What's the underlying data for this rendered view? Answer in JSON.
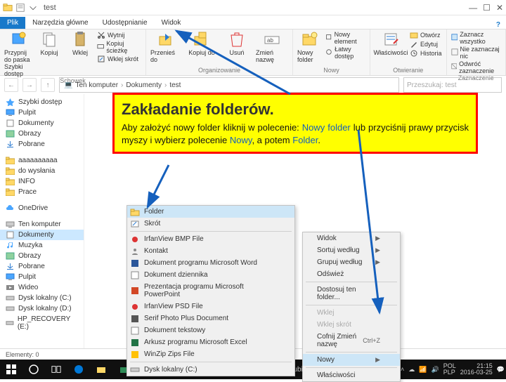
{
  "titlebar": {
    "title": "test"
  },
  "tabs": {
    "plik": "Plik",
    "glowne": "Narzędzia główne",
    "udostep": "Udostępnianie",
    "widok": "Widok"
  },
  "ribbon": {
    "group1": {
      "pin": "Przypnij do paska Szybki dostęp",
      "kopiuj": "Kopiuj",
      "wklej": "Wklej",
      "wytnij": "Wytnij",
      "skopiuj_sciezke": "Kopiuj ścieżkę",
      "wklej_skrot": "Wklej skrót",
      "label": "Schowek"
    },
    "group2": {
      "przenies": "Przenieś do",
      "kopiuj_do": "Kopiuj do",
      "usun": "Usuń",
      "zmien": "Zmień nazwę",
      "label": "Organizowanie"
    },
    "group3": {
      "nowy": "Nowy folder",
      "nowy_el": "Nowy element",
      "latwy": "Łatwy dostęp",
      "label": "Nowy"
    },
    "group4": {
      "wlasc": "Właściwości",
      "otworz": "Otwórz",
      "edytuj": "Edytuj",
      "historia": "Historia",
      "label": "Otwieranie"
    },
    "group5": {
      "zaznacz": "Zaznacz wszystko",
      "nie": "Nie zaznaczaj nic",
      "odwroc": "Odwróć zaznaczenie",
      "label": "Zaznaczenie"
    }
  },
  "nav": {
    "crumbs": [
      "Ten komputer",
      "Dokumenty",
      "test"
    ],
    "search_placeholder": "Przeszukaj: test"
  },
  "sidebar": {
    "quick": "Szybki dostęp",
    "items": [
      "Pulpit",
      "Dokumenty",
      "Obrazy",
      "Pobrane",
      "",
      "aaaaaaaaaa",
      "do wysłania",
      "INFO",
      "Prace",
      "",
      "OneDrive",
      "",
      "Ten komputer",
      "Dokumenty",
      "Muzyka",
      "Obrazy",
      "Pobrane",
      "Pulpit",
      "Wideo",
      "Dysk lokalny (C:)",
      "Dysk lokalny (D:)",
      "HP_RECOVERY (E:)"
    ]
  },
  "callout": {
    "title": "Zakładanie folderów.",
    "line1_a": "Aby założyć nowy folder kliknij w polecenie: ",
    "line1_b": "Nowy folder",
    "line1_c": " lub przyciśnij prawy przycisk myszy i wybierz polecenie ",
    "line1_d": "Nowy",
    "line1_e": ", a potem ",
    "line1_f": "Folder",
    "line1_g": "."
  },
  "ctx_right": {
    "items": [
      "Widok",
      "Sortuj według",
      "Grupuj według",
      "Odśwież",
      "",
      "Dostosuj ten folder...",
      "",
      "Wklej",
      "Wklej skrót",
      "Cofnij Zmień nazwę",
      "",
      "Nowy",
      "",
      "Właściwości"
    ],
    "shortcut": "Ctrl+Z"
  },
  "ctx_new": {
    "items": [
      "Folder",
      "Skrót",
      "IrfanView BMP File",
      "Kontakt",
      "Dokument programu Microsoft Word",
      "Dokument dziennika",
      "Prezentacja programu Microsoft PowerPoint",
      "IrfanView PSD File",
      "Serif Photo Plus Document",
      "Dokument tekstowy",
      "Arkusz programu Microsoft Excel",
      "WinZip Zips File",
      "Dysk lokalny (C:)"
    ]
  },
  "status": {
    "text": "Elementy: 0"
  },
  "taskbar": {
    "centertext": "SP 8  Lubin",
    "lang": "POL\nPLP",
    "time": "21:15",
    "date": "2016-03-25"
  }
}
